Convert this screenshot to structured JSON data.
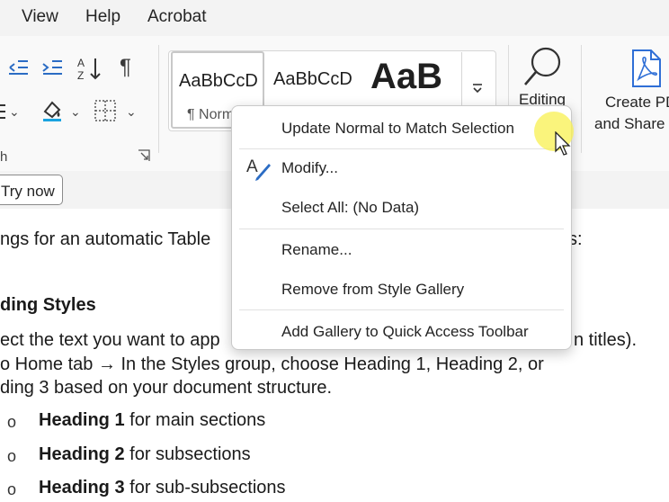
{
  "menubar": {
    "items": [
      "View",
      "Help",
      "Acrobat"
    ]
  },
  "ribbon": {
    "group_label_fragment": "h",
    "try_now_label": "Try now",
    "styles": {
      "tile1_sample": "AaBbCcD",
      "tile1_name": "¶ Norm",
      "tile2_sample": "AaBbCcD",
      "tile3_sample": "AaB"
    },
    "editing_label": "Editing",
    "create_pdf_line1": "Create PD",
    "create_pdf_line2": "and Share"
  },
  "document": {
    "line1": "ngs for an automatic Table",
    "line1_tail": "s:",
    "heading": "ding Styles",
    "line2": "ect the text you want to app",
    "line2_tail": "n titles).",
    "line3": "o Home tab → In the Styles group, choose Heading 1, Heading 2, or",
    "line4": "ding 3 based on your document structure.",
    "bullets": [
      {
        "bold": "Heading 1",
        "rest": " for main sections"
      },
      {
        "bold": "Heading 2",
        "rest": " for subsections"
      },
      {
        "bold": "Heading 3",
        "rest": " for sub-subsections"
      }
    ],
    "bullet_glyph": "o"
  },
  "context_menu": {
    "items": [
      "Update Normal to Match Selection",
      "Modify...",
      "Select All: (No Data)",
      "Rename...",
      "Remove from Style Gallery",
      "Add Gallery to Quick Access Toolbar"
    ]
  },
  "colors": {
    "highlight": "#f8f050",
    "acrobat_blue": "#2f6fd6",
    "modify_icon_blue": "#2b6cc4"
  }
}
